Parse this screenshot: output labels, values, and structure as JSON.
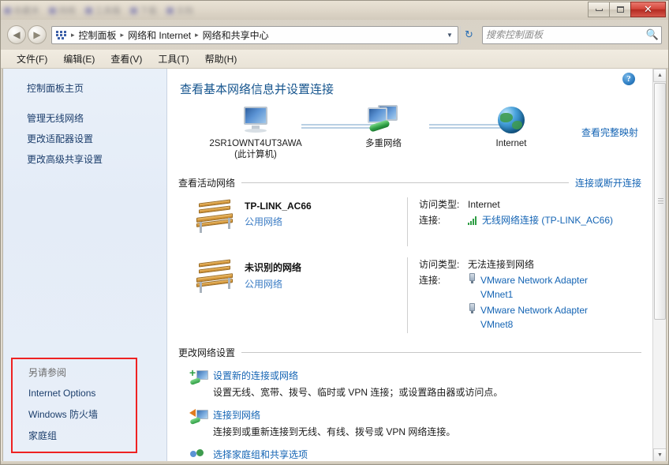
{
  "window": {
    "minimize_label": "",
    "maximize_label": "",
    "close_label": "✕",
    "obscured_items": [
      "收藏夹",
      "网络",
      "工具箱",
      "下载",
      "文档"
    ]
  },
  "nav": {
    "back_glyph": "◀",
    "forward_glyph": "▶",
    "breadcrumb": [
      "控制面板",
      "网络和 Internet",
      "网络和共享中心"
    ],
    "separator": "▸",
    "dropdown_glyph": "▼",
    "refresh_glyph": "↻"
  },
  "search": {
    "placeholder": "搜索控制面板",
    "value": "",
    "icon": "search-icon"
  },
  "menubar": {
    "items": [
      {
        "label": "文件(F)"
      },
      {
        "label": "编辑(E)"
      },
      {
        "label": "查看(V)"
      },
      {
        "label": "工具(T)"
      },
      {
        "label": "帮助(H)"
      }
    ]
  },
  "sidebar": {
    "home_link": "控制面板主页",
    "items": [
      {
        "label": "管理无线网络"
      },
      {
        "label": "更改适配器设置"
      },
      {
        "label": "更改高级共享设置"
      }
    ],
    "see_also": {
      "heading": "另请参阅",
      "highlight_color": "#ee2222",
      "items": [
        {
          "label": "Internet Options"
        },
        {
          "label": "Windows 防火墙"
        },
        {
          "label": "家庭组"
        }
      ]
    }
  },
  "main": {
    "help_glyph": "?",
    "page_title": "查看基本网络信息并设置连接",
    "network_map": {
      "nodes": [
        {
          "name": "2SR1OWNT4UT3AWA",
          "sub": "(此计算机)",
          "icon": "computer-icon"
        },
        {
          "name": "多重网络",
          "sub": "",
          "icon": "multiple-networks-icon"
        },
        {
          "name": "Internet",
          "sub": "",
          "icon": "globe-icon"
        }
      ],
      "view_full_map": "查看完整映射"
    },
    "active_networks": {
      "heading": "查看活动网络",
      "action": "连接或断开连接",
      "networks": [
        {
          "name": "TP-LINK_AC66",
          "type": "公用网络",
          "icon": "bench-icon",
          "access_label": "访问类型:",
          "access_value": "Internet",
          "connections_label": "连接:",
          "connections": [
            {
              "text": "无线网络连接 (TP-LINK_AC66)",
              "icon": "wifi-signal-icon"
            }
          ]
        },
        {
          "name": "未识别的网络",
          "type": "公用网络",
          "icon": "bench-icon",
          "access_label": "访问类型:",
          "access_value": "无法连接到网络",
          "connections_label": "连接:",
          "connections": [
            {
              "text": "VMware Network Adapter VMnet1",
              "icon": "network-adapter-icon"
            },
            {
              "text": "VMware Network Adapter VMnet8",
              "icon": "network-adapter-icon"
            }
          ]
        }
      ]
    },
    "change_settings": {
      "heading": "更改网络设置",
      "items": [
        {
          "title": "设置新的连接或网络",
          "desc": "设置无线、宽带、拨号、临时或 VPN 连接；或设置路由器或访问点。",
          "icon": "new-connection-icon"
        },
        {
          "title": "连接到网络",
          "desc": "连接到或重新连接到无线、有线、拨号或 VPN 网络连接。",
          "icon": "connect-network-icon"
        },
        {
          "title": "选择家庭组和共享选项",
          "desc": "",
          "icon": "homegroup-icon"
        }
      ]
    }
  },
  "scrollbar": {
    "up_glyph": "▲",
    "down_glyph": "▼"
  },
  "colors": {
    "link": "#1464b4",
    "title": "#16558e",
    "highlight_box": "#ee2222",
    "sidebar_bg": "#e4ecf7"
  }
}
